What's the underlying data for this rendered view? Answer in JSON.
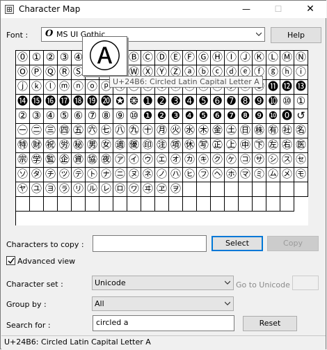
{
  "window": {
    "title": "Character Map",
    "minimize": "—",
    "maximize": "☐",
    "close": "✕"
  },
  "font": {
    "label": "Font :",
    "icon": "opentype-icon",
    "value": "MS UI Gothic",
    "help_label": "Help"
  },
  "grid": {
    "cells": [
      "⓪",
      "①",
      "②",
      "③",
      "④",
      "⑤",
      "⑥",
      "Ⓐ",
      "Ⓑ",
      "Ⓒ",
      "Ⓓ",
      "Ⓔ",
      "Ⓕ",
      "Ⓖ",
      "Ⓗ",
      "Ⓘ",
      "Ⓙ",
      "Ⓚ",
      "Ⓛ",
      "Ⓜ",
      "Ⓝ",
      "Ⓞ",
      "Ⓟ",
      "Ⓠ",
      "Ⓡ",
      "Ⓢ",
      "Ⓣ",
      "Ⓤ",
      "Ⓥ",
      "Ⓦ",
      "Ⓧ",
      "Ⓨ",
      "Ⓩ",
      "ⓐ",
      "ⓑ",
      "ⓒ",
      "ⓓ",
      "ⓔ",
      "ⓕ",
      "ⓖ",
      "ⓗ",
      "ⓘ",
      "ⓙ",
      "ⓚ",
      "ⓛ",
      "ⓜ",
      "ⓝ",
      "ⓞ",
      "ⓟ",
      "ⓠ",
      "ⓡ",
      "ⓢ",
      "ⓣ",
      "ⓤ",
      "ⓥ",
      "ⓦ",
      "ⓧ",
      "ⓨ",
      "ⓩ",
      "⓪",
      "⓫",
      "⓬",
      "⓭",
      "⓮",
      "⓯",
      "⓰",
      "⓱",
      "⓲",
      "⓳",
      "⓴",
      "✪",
      "❂",
      "➊",
      "➋",
      "➌",
      "➍",
      "➎",
      "➏",
      "➐",
      "➑",
      "➒",
      "➓",
      "⑩",
      "①",
      "②",
      "③",
      "④",
      "⑤",
      "⑥",
      "⑦",
      "⑧",
      "⑨",
      "⑩",
      "❶",
      "❷",
      "❸",
      "❹",
      "❺",
      "❻",
      "❼",
      "❽",
      "❾",
      "❿",
      "⓿",
      "↺",
      "㊀",
      "㊁",
      "㊂",
      "㊃",
      "㊄",
      "㊅",
      "㊆",
      "㊇",
      "㊈",
      "㊉",
      "㊊",
      "㊋",
      "㊌",
      "㊍",
      "㊎",
      "㊏",
      "㊐",
      "㊑",
      "㊒",
      "㊓",
      "㊔",
      "㊕",
      "㊖",
      "㊗",
      "㊘",
      "㊙",
      "㊚",
      "㊛",
      "㊜",
      "㊝",
      "㊞",
      "㊟",
      "㊠",
      "㊡",
      "㊢",
      "㊣",
      "㊤",
      "㊥",
      "㊦",
      "㊧",
      "㊨",
      "㊩",
      "㊪",
      "㊫",
      "㊬",
      "㊭",
      "㊮",
      "㊯",
      "㊰",
      "㋐",
      "㋑",
      "㋒",
      "㋓",
      "㋔",
      "㋕",
      "㋖",
      "㋗",
      "㋘",
      "㋙",
      "㋚",
      "㋛",
      "㋜",
      "㋝",
      "㋞",
      "㋟",
      "㋠",
      "㋡",
      "㋢",
      "㋣",
      "㋤",
      "㋥",
      "㋦",
      "㋧",
      "㋨",
      "㋩",
      "㋪",
      "㋫",
      "㋬",
      "㋭",
      "㋮",
      "㋯",
      "㋰",
      "㋱",
      "㋲",
      "㋳",
      "㋴",
      "㋵",
      "㋶",
      "㋷",
      "㋸",
      "㋹",
      "㋺",
      "㋻",
      "㋼",
      "㋽",
      "㋾",
      "",
      "",
      "",
      "",
      "",
      "",
      "",
      "",
      "",
      "",
      "",
      "",
      "",
      "",
      "",
      "",
      "",
      "",
      "",
      "",
      "",
      "",
      "",
      "",
      "",
      "",
      "",
      "",
      ""
    ]
  },
  "magnifier": {
    "char": "Ⓐ"
  },
  "tooltip": {
    "text": "U+24B6: Circled Latin Capital Letter A"
  },
  "copy": {
    "label": "Characters to copy :",
    "value": "",
    "select_label": "Select",
    "copy_label": "Copy"
  },
  "advanced": {
    "label": "Advanced view",
    "checked": true
  },
  "charset": {
    "label": "Character set :",
    "value": "Unicode",
    "goto_label": "Go to Unicode :",
    "goto_value": ""
  },
  "groupby": {
    "label": "Group by :",
    "value": "All"
  },
  "search": {
    "label": "Search for :",
    "value": "circled a",
    "reset_label": "Reset"
  },
  "status": {
    "text": "U+24B6: Circled Latin Capital Letter A"
  }
}
